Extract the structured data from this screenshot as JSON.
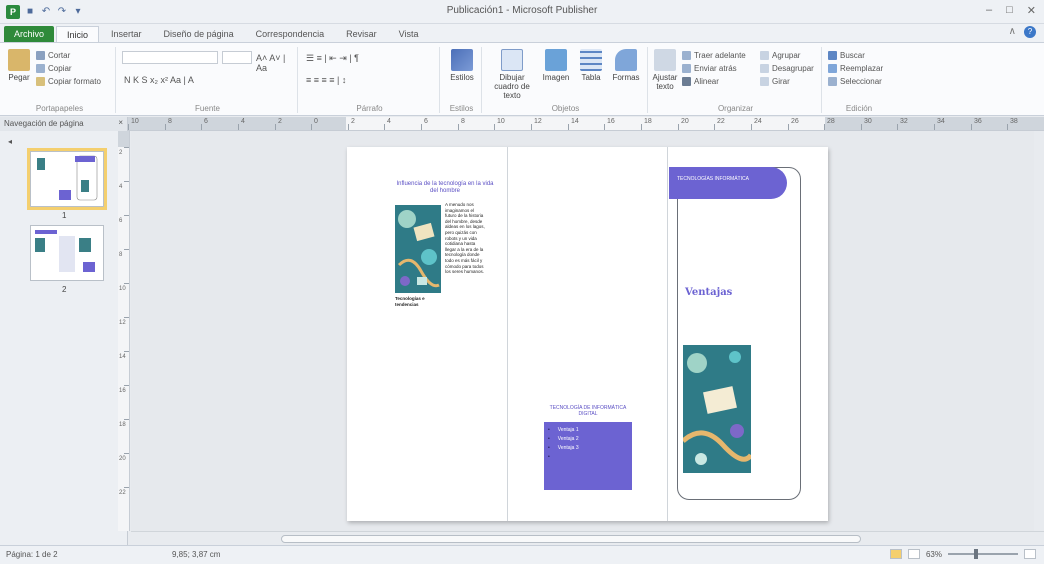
{
  "window": {
    "title": "Publicación1 - Microsoft Publisher",
    "min_glyph": "–",
    "max_glyph": "□",
    "close_glyph": "✕"
  },
  "qat": {
    "app_icon": "P",
    "save_glyph": "■",
    "undo_glyph": "↶",
    "redo_glyph": "↷",
    "more_glyph": "▾"
  },
  "tabs": [
    "Archivo",
    "Inicio",
    "Insertar",
    "Diseño de página",
    "Correspondencia",
    "Revisar",
    "Vista"
  ],
  "help": {
    "caret": "∧",
    "icon": "?"
  },
  "ribbon": {
    "clipboard": {
      "paste": "Pegar",
      "cut": "Cortar",
      "copy": "Copiar",
      "format_painter": "Copiar formato",
      "label": "Portapapeles"
    },
    "font": {
      "label": "Fuente",
      "row1": "A˄  A˅  |  Aa",
      "row2": "N   K   S   x₂   x²   Aa   |   A"
    },
    "paragraph": {
      "label": "Párrafo",
      "row1": "☰  ≡  |  ⇤  ⇥  |  ¶",
      "row2": "≡  ≡  ≡  ≡  |  ↕"
    },
    "styles": {
      "label": "Estilos",
      "btn": "Estilos"
    },
    "objects": {
      "label": "Objetos",
      "draw_textbox": "Dibujar cuadro de texto",
      "image": "Imagen",
      "table": "Tabla",
      "shapes": "Formas"
    },
    "arrange": {
      "label": "Organizar",
      "wrap_text": "Ajustar texto",
      "bring_forward": "Traer adelante",
      "send_backward": "Enviar atrás",
      "align": "Alinear",
      "group": "Agrupar",
      "ungroup": "Desagrupar",
      "rotate": "Girar"
    },
    "editing": {
      "label": "Edición",
      "find": "Buscar",
      "replace": "Reemplazar",
      "select": "Seleccionar"
    }
  },
  "navpane": {
    "title": "Navegación de página",
    "close_glyph": "×",
    "collapse_glyph": "◂",
    "pages": [
      {
        "num": "1"
      },
      {
        "num": "2"
      }
    ]
  },
  "ruler": {
    "h_numbers": [
      "10",
      "8",
      "6",
      "4",
      "2",
      "0",
      "2",
      "4",
      "6",
      "8",
      "10",
      "12",
      "14",
      "16",
      "18",
      "20",
      "22",
      "24",
      "26",
      "28",
      "30",
      "32",
      "34",
      "36",
      "38"
    ],
    "v_numbers": [
      "2",
      "4",
      "6",
      "8",
      "10",
      "12",
      "14",
      "16",
      "18",
      "20",
      "22"
    ]
  },
  "page": {
    "panel1": {
      "title": "Influencia de la tecnología en la vida del hombre",
      "body": "A menudo nos imaginamos el futuro de la historia del hombre, desde aldeas en los lagos, pero quizás con robots y un vida cotidiana hasta llegar a la era de la tecnología donde todo es más fácil y cómodo para todos los seres humanos.",
      "caption": "Tecnologías e tendencias"
    },
    "panel2": {
      "heading": "TECNOLOGÍA DE INFORMÁTICA DIGITAL",
      "items": [
        "Ventaja 1",
        "Ventaja 2",
        "Ventaja 3",
        ""
      ]
    },
    "panel3": {
      "banner": "TECNOLOGÍAS INFORMÁTICA",
      "title": "Ventajas"
    }
  },
  "status": {
    "page": "Página: 1 de 2",
    "position": "9,85; 3,87 cm",
    "zoom": "63%"
  },
  "colors": {
    "accent": "#6c63d2",
    "file_tab": "#2f8a3a",
    "selection": "#f4cf6e"
  }
}
